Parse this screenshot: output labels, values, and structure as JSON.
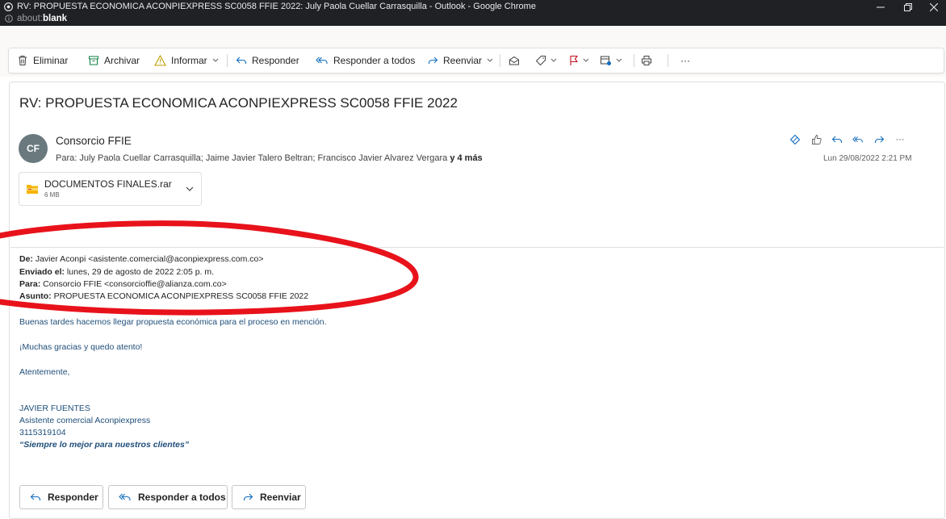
{
  "window": {
    "title": "RV: PROPUESTA ECONOMICA ACONPIEXPRESS SC0058 FFIE 2022: July Paola Cuellar Carrasquilla - Outlook - Google Chrome",
    "url_prefix": "about:",
    "url_bold": "blank"
  },
  "toolbar": {
    "delete_label": "Eliminar",
    "archive_label": "Archivar",
    "report_label": "Informar",
    "reply_label": "Responder",
    "reply_all_label": "Responder a todos",
    "forward_label": "Reenviar",
    "more_label": "···"
  },
  "message": {
    "subject": "RV: PROPUESTA ECONOMICA ACONPIEXPRESS SC0058 FFIE 2022",
    "avatar_initials": "CF",
    "sender": "Consorcio FFIE",
    "to_prefix": "Para:",
    "to_list": "July Paola Cuellar Carrasquilla;  Jaime Javier Talero Beltran;  Francisco Javier Alvarez Vergara",
    "to_more": "y 4 más",
    "date": "Lun 29/08/2022 2:21 PM",
    "more_actions": "···"
  },
  "attachment": {
    "name": "DOCUMENTOS FINALES.rar",
    "size": "6 MB"
  },
  "forwarded": {
    "from_label": "De:",
    "from_value": " Javier Aconpi <asistente.comercial@aconpiexpress.com.co>",
    "sent_label": "Enviado el:",
    "sent_value": " lunes, 29 de agosto de 2022 2:05 p. m.",
    "to_label": "Para:",
    "to_value": " Consorcio FFIE <consorcioffie@alianza.com.co>",
    "subject_label": "Asunto:",
    "subject_value": " PROPUESTA ECONOMICA ACONPIEXPRESS SC0058 FFIE 2022"
  },
  "body": {
    "line1": "Buenas tardes hacemos llegar propuesta económica para el proceso en mención.",
    "line2": "¡Muchas gracias y quedo atento!",
    "line3": "Atentemente,",
    "sig_name": "JAVIER FUENTES",
    "sig_title": "Asistente comercial Aconpiexpress",
    "sig_phone": "3115319104",
    "sig_slogan": "“Siempre lo mejor para nuestros clientes”"
  },
  "footer": {
    "reply_label": "Responder",
    "reply_all_label": "Responder a todos",
    "forward_label": "Reenviar"
  },
  "colors": {
    "annotation_red": "#e8121b",
    "body_text_blue": "#1f4e79",
    "avatar_bg": "#69797e",
    "accent": "#0f6cbd"
  }
}
